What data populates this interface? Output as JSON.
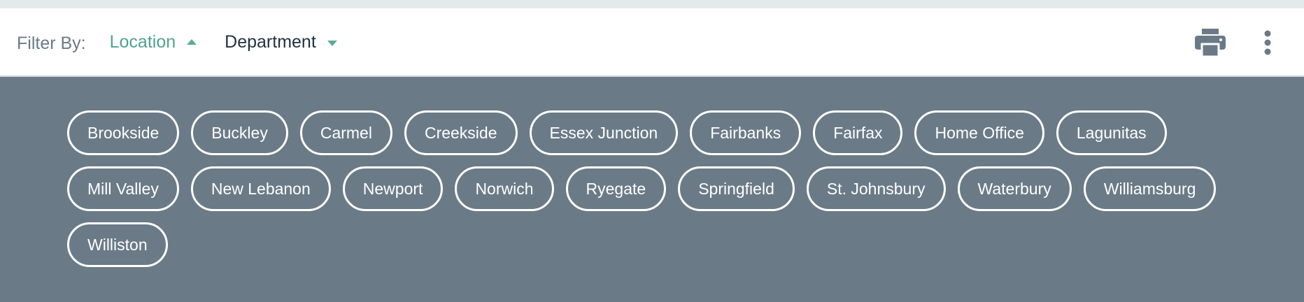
{
  "filter_bar": {
    "label": "Filter By:",
    "tabs": [
      {
        "label": "Location",
        "state": "expanded"
      },
      {
        "label": "Department",
        "state": "collapsed"
      }
    ],
    "actions": [
      "print-icon",
      "more-vertical-icon"
    ]
  },
  "locations": [
    "Brookside",
    "Buckley",
    "Carmel",
    "Creekside",
    "Essex Junction",
    "Fairbanks",
    "Fairfax",
    "Home Office",
    "Lagunitas",
    "Mill Valley",
    "New Lebanon",
    "Newport",
    "Norwich",
    "Ryegate",
    "Springfield",
    "St. Johnsbury",
    "Waterbury",
    "Williamsburg",
    "Williston"
  ],
  "colors": {
    "accent": "#4fa38e",
    "panel_bg": "#6b7a87",
    "text_dark": "#1f3140",
    "label_gray": "#6b7a86"
  }
}
